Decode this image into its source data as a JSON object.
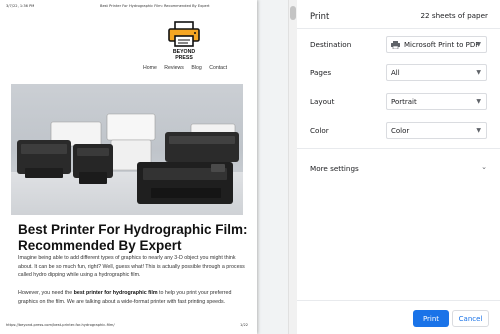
{
  "preview": {
    "header_date": "3/7/22, 1:36 PM",
    "header_title": "Best Printer For Hydrographic Film: Recommended By Expert",
    "logo_text": "BEYOND PRESS",
    "nav": [
      "Home",
      "Reviews",
      "Blog",
      "Contact"
    ],
    "article_title": "Best Printer For Hydrographic Film: Recommended By Expert",
    "para1": "Imagine being able to add different types of graphics to nearly any 3-D object you might think about. It can be so much fun, right? Well, guess what! This is actually possible through a process called hydro dipping while using a hydrographic film.",
    "para2_before": "However, you need the ",
    "para2_bold": "best printer for hydrographic film",
    "para2_after": " to help you print your preferred graphics on the film. We are talking about a wide-format printer with fast printing speeds.",
    "footer_url": "https://beyond-press.com/best-printer-for-hydrographic-film/",
    "footer_page": "1/22"
  },
  "panel": {
    "title": "Print",
    "sheets": "22 sheets of paper",
    "destination": {
      "label": "Destination",
      "value": "Microsoft Print to PDF"
    },
    "pages": {
      "label": "Pages",
      "value": "All"
    },
    "layout": {
      "label": "Layout",
      "value": "Portrait"
    },
    "color": {
      "label": "Color",
      "value": "Color"
    },
    "more_settings": "More settings",
    "print_label": "Print",
    "cancel_label": "Cancel"
  },
  "colors": {
    "accent": "#1a73e8",
    "logo_orange": "#f5a623",
    "preview_bg": "#f1f3f4"
  },
  "icons": [
    "printer-icon",
    "chevron-down-icon",
    "logo-printer-icon"
  ]
}
